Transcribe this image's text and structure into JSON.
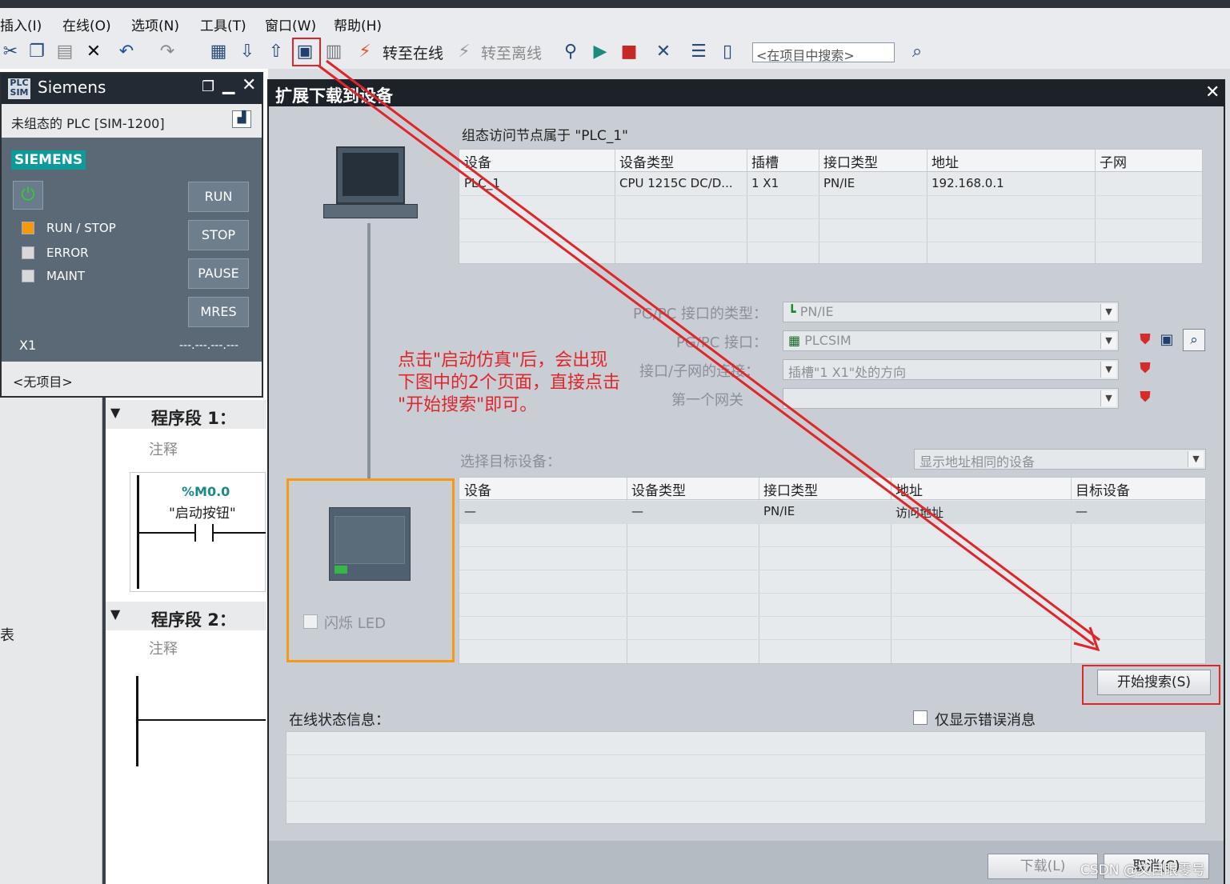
{
  "menu": {
    "items": [
      "插入(I)",
      "在线(O)",
      "选项(N)",
      "工具(T)",
      "窗口(W)",
      "帮助(H)"
    ]
  },
  "toolbar": {
    "go_online": "转至在线",
    "go_offline": "转至离线",
    "search_placeholder": "<在项目中搜索>"
  },
  "plcsim": {
    "title": "Siemens",
    "subtitle": "未组态的 PLC [SIM-1200]",
    "brand": "SIEMENS",
    "buttons": [
      "RUN",
      "STOP",
      "PAUSE",
      "MRES"
    ],
    "leds": [
      {
        "label": "RUN / STOP",
        "color": "#f59a0e"
      },
      {
        "label": "ERROR",
        "color": "#d8d8d8"
      },
      {
        "label": "MAINT",
        "color": "#d8d8d8"
      }
    ],
    "port": "X1",
    "address": "---.---.---.---",
    "project": "<无项目>"
  },
  "editor": {
    "segment1": "程序段 1：",
    "segment2": "程序段 2：",
    "comment": "注释",
    "contact_address": "%M0.0",
    "contact_name": "\"启动按钮\"",
    "left_label": "表"
  },
  "dialog": {
    "title": "扩展下载到设备",
    "config_heading": "组态访问节点属于 \"PLC_1\"",
    "config_columns": [
      "设备",
      "设备类型",
      "插槽",
      "接口类型",
      "地址",
      "子网"
    ],
    "config_rows": [
      [
        "PLC_1",
        "CPU 1215C DC/D...",
        "1 X1",
        "PN/IE",
        "192.168.0.1",
        ""
      ]
    ],
    "pgpc_type_label": "PG/PC 接口的类型：",
    "pgpc_type_value": "PN/IE",
    "pgpc_iface_label": "PG/PC 接口：",
    "pgpc_iface_value": "PLCSIM",
    "subnet_conn_label": "接口/子网的连接：",
    "subnet_conn_value": "插槽\"1 X1\"处的方向",
    "gateway_label": "第一个网关",
    "gateway_value": "",
    "select_target_label": "选择目标设备：",
    "filter_value": "显示地址相同的设备",
    "target_columns": [
      "设备",
      "设备类型",
      "接口类型",
      "地址",
      "目标设备"
    ],
    "target_rows": [
      [
        "—",
        "—",
        "PN/IE",
        "访问地址",
        "—"
      ]
    ],
    "flash_led": "闪烁 LED",
    "start_search": "开始搜索(S)",
    "online_status_label": "在线状态信息：",
    "only_errors": "仅显示错误消息",
    "download": "下载(L)",
    "cancel": "取消(C)"
  },
  "annotation": {
    "lines": [
      "点击\"启动仿真\"后，会出现",
      "下图中的2个页面，直接点击",
      "\"开始搜索\"即可。"
    ],
    "color": "#e0252b"
  },
  "watermark": "CSDN @文目眼零号"
}
